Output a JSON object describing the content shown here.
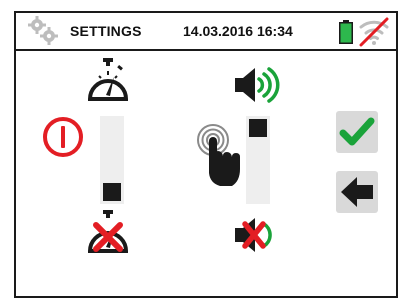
{
  "header": {
    "title": "SETTINGS",
    "datetime": "14.03.2016 16:34"
  },
  "icons": {
    "settings": "gears-icon",
    "battery": "battery-full-icon",
    "wifi": "wifi-off-icon",
    "power": "power-icon",
    "timer_on": "stopwatch-icon",
    "timer_off": "stopwatch-off-icon",
    "touch": "touch-tap-icon",
    "sound_on": "speaker-on-icon",
    "sound_off": "speaker-off-icon",
    "confirm": "checkmark-icon",
    "back": "arrow-left-icon"
  },
  "controls": {
    "auto_power_off": {
      "level_fraction": 0.0
    },
    "key_sound": {
      "level_fraction": 1.0
    }
  },
  "colors": {
    "accent_red": "#e31e24",
    "accent_green": "#1aa33a",
    "battery_green": "#2db84d",
    "button_bg": "#d9d9d9",
    "icon_dark": "#1a1a1a"
  }
}
